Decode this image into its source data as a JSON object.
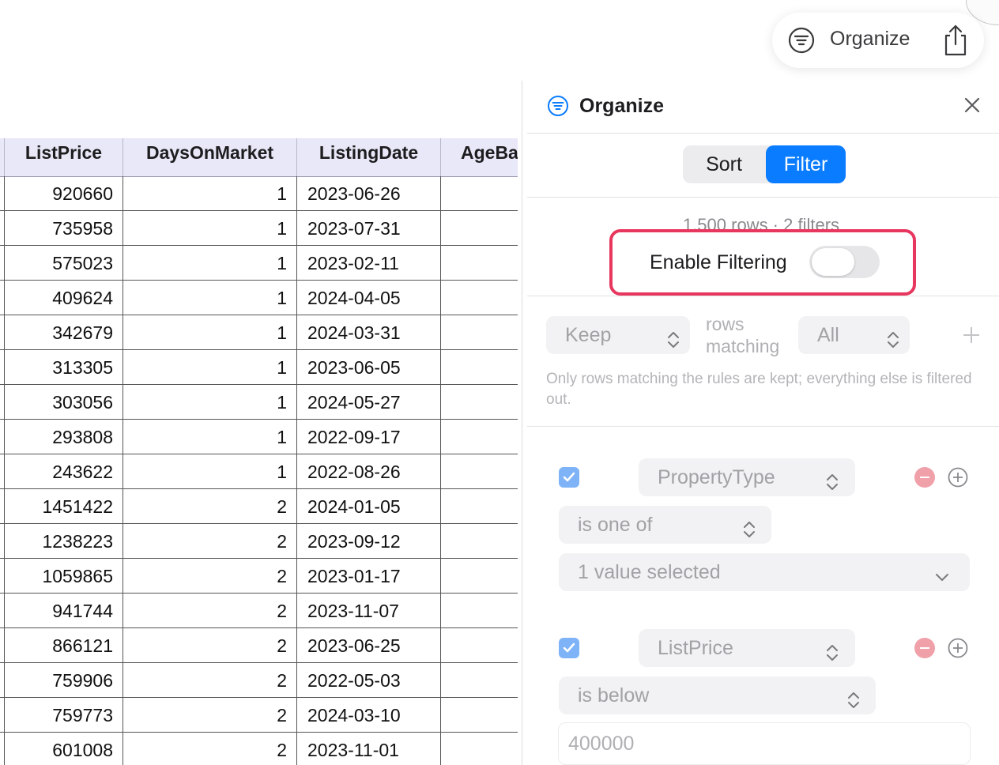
{
  "toolbar": {
    "organize_label": "Organize"
  },
  "table": {
    "columns": [
      "ListPrice",
      "DaysOnMarket",
      "ListingDate",
      "AgeBa"
    ],
    "rows": [
      [
        "920660",
        "1",
        "2023-06-26"
      ],
      [
        "735958",
        "1",
        "2023-07-31"
      ],
      [
        "575023",
        "1",
        "2023-02-11"
      ],
      [
        "409624",
        "1",
        "2024-04-05"
      ],
      [
        "342679",
        "1",
        "2024-03-31"
      ],
      [
        "313305",
        "1",
        "2023-06-05"
      ],
      [
        "303056",
        "1",
        "2024-05-27"
      ],
      [
        "293808",
        "1",
        "2022-09-17"
      ],
      [
        "243622",
        "1",
        "2022-08-26"
      ],
      [
        "1451422",
        "2",
        "2024-01-05"
      ],
      [
        "1238223",
        "2",
        "2023-09-12"
      ],
      [
        "1059865",
        "2",
        "2023-01-17"
      ],
      [
        "941744",
        "2",
        "2023-11-07"
      ],
      [
        "866121",
        "2",
        "2023-06-25"
      ],
      [
        "759906",
        "2",
        "2022-05-03"
      ],
      [
        "759773",
        "2",
        "2024-03-10"
      ],
      [
        "601008",
        "2",
        "2023-11-01"
      ]
    ]
  },
  "panel": {
    "title": "Organize",
    "tabs": {
      "sort": "Sort",
      "filter": "Filter",
      "active": "Filter"
    },
    "summary": "1,500 rows · 2 filters",
    "enable_filtering_label": "Enable Filtering",
    "enable_filtering_on": false,
    "mode_select": "Keep",
    "rows_matching_label_1": "rows",
    "rows_matching_label_2": "matching",
    "match_select": "All",
    "help_text": "Only rows matching the rules are kept; everything else is filtered out.",
    "highlight_color": "#e8375f",
    "accent_color": "#0a7cff",
    "filters": [
      {
        "enabled": true,
        "field": "PropertyType",
        "operator": "is one of",
        "value": "1 value selected"
      },
      {
        "enabled": true,
        "field": "ListPrice",
        "operator": "is below",
        "value": "400000"
      }
    ]
  }
}
